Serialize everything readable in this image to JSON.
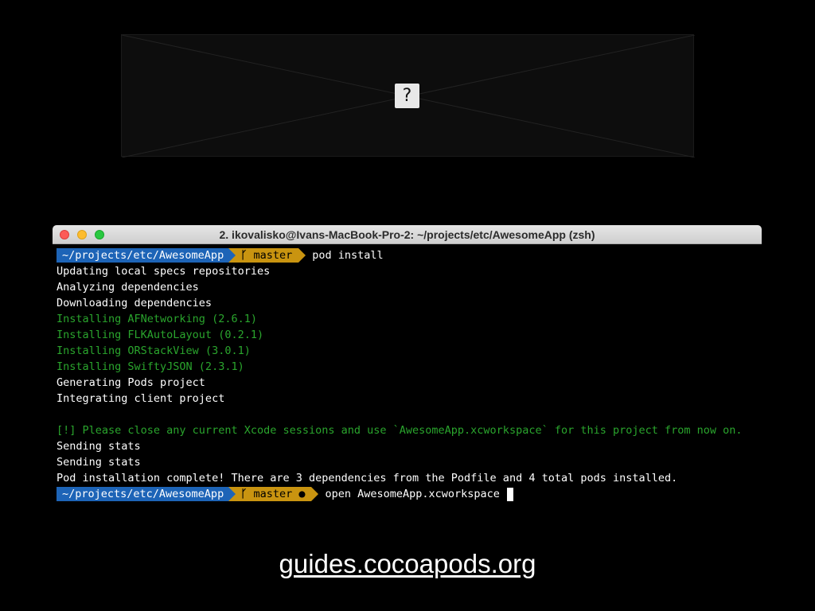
{
  "slide": {
    "broken_image_icon": "?",
    "footer_link": "guides.cocoapods.org"
  },
  "terminal": {
    "title": "2. ikovalisko@Ivans-MacBook-Pro-2: ~/projects/etc/AwesomeApp (zsh)",
    "prompt1": {
      "path": "~/projects/etc/AwesomeApp",
      "branch": "master",
      "command": "pod install"
    },
    "output": [
      {
        "text": "Updating local specs repositories",
        "color": "#ffffff"
      },
      {
        "text": "Analyzing dependencies",
        "color": "#ffffff"
      },
      {
        "text": "Downloading dependencies",
        "color": "#ffffff"
      },
      {
        "text": "Installing AFNetworking (2.6.1)",
        "color": "#2aa52d"
      },
      {
        "text": "Installing FLKAutoLayout (0.2.1)",
        "color": "#2aa52d"
      },
      {
        "text": "Installing ORStackView (3.0.1)",
        "color": "#2aa52d"
      },
      {
        "text": "Installing SwiftyJSON (2.3.1)",
        "color": "#2aa52d"
      },
      {
        "text": "Generating Pods project",
        "color": "#ffffff"
      },
      {
        "text": "Integrating client project",
        "color": "#ffffff"
      },
      {
        "text": "",
        "color": "#ffffff"
      },
      {
        "text": "[!] Please close any current Xcode sessions and use `AwesomeApp.xcworkspace` for this project from now on.",
        "color": "#2aa52d"
      },
      {
        "text": "Sending stats",
        "color": "#ffffff"
      },
      {
        "text": "Sending stats",
        "color": "#ffffff"
      },
      {
        "text": "Pod installation complete! There are 3 dependencies from the Podfile and 4 total pods installed.",
        "color": "#ffffff"
      }
    ],
    "prompt2": {
      "path": "~/projects/etc/AwesomeApp",
      "branch": "master ●",
      "command": "open AwesomeApp.xcworkspace"
    },
    "branch_glyph": "ᚴ",
    "colors": {
      "path_bg": "#1d64b7",
      "branch_bg": "#c99410",
      "success_green": "#2aa52d"
    }
  }
}
